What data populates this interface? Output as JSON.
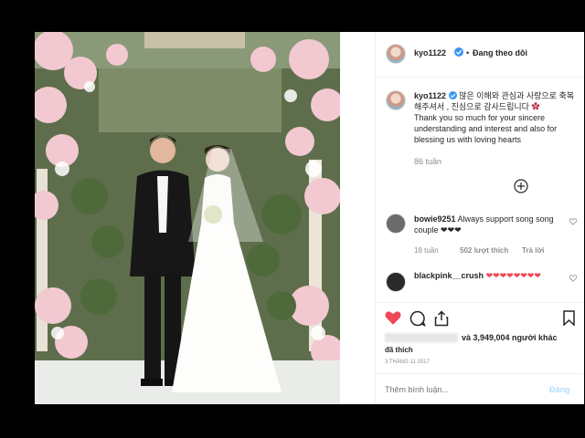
{
  "header": {
    "username": "kyo1122",
    "separator": "•",
    "follow_status": "Đang theo dõi"
  },
  "caption": {
    "username": "kyo1122",
    "korean": "많은 이해와 관심과 사랑으로 축복해주셔서 , 진심으로 감사드립니다",
    "english": "Thank you so much for your sincere understanding and interest and also for blessing us with loving hearts",
    "time": "86 tuần"
  },
  "load_more_symbol": "⊕",
  "comments": [
    {
      "username": "bowie9251",
      "text": "Always support song song couple ❤❤❤",
      "time": "18 tuần",
      "likes": "502 lượt thích",
      "reply": "Trả lời"
    },
    {
      "username": "blackpink__crush",
      "text": "❤❤❤❤❤❤❤❤"
    }
  ],
  "likes": {
    "text": "và 3,949,004 người khác",
    "suffix": "đã thích"
  },
  "date": "3 THÁNG 11 2017",
  "comment_box": {
    "placeholder": "Thêm bình luận...",
    "post_label": "Đăng"
  },
  "colors": {
    "like_red": "#ed4956",
    "link_blue": "#3897f0",
    "verified_blue": "#3897f0"
  },
  "icons": [
    "heart-icon",
    "comment-icon",
    "share-icon",
    "bookmark-icon",
    "verified-icon",
    "plus-circle-icon",
    "small-heart-icon"
  ]
}
